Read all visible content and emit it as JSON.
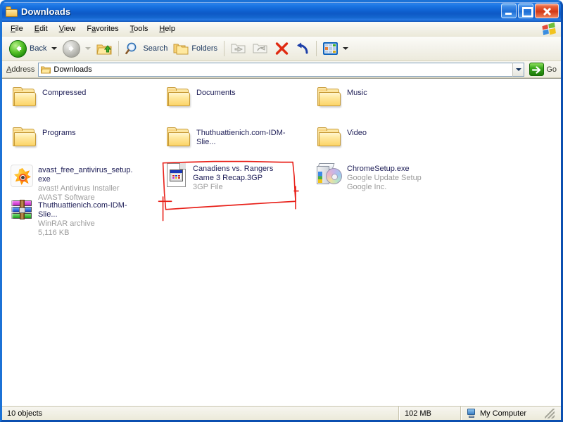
{
  "window": {
    "title": "Downloads",
    "folder_icon": "folder-icon",
    "buttons": {
      "minimize": "minimize-button",
      "maximize": "maximize-button",
      "close": "close-button"
    }
  },
  "menubar": {
    "items": [
      {
        "label": "File",
        "accel": "F"
      },
      {
        "label": "Edit",
        "accel": "E"
      },
      {
        "label": "View",
        "accel": "V"
      },
      {
        "label": "Favorites",
        "accel": "a"
      },
      {
        "label": "Tools",
        "accel": "T"
      },
      {
        "label": "Help",
        "accel": "H"
      }
    ],
    "logo": "windows-flag-logo"
  },
  "toolbar": {
    "back_label": "Back",
    "search_label": "Search",
    "folders_label": "Folders",
    "icons": {
      "back": "back-arrow-icon",
      "forward": "forward-arrow-icon",
      "up": "up-folder-icon",
      "search": "magnifier-icon",
      "folders": "folders-icon",
      "move_to": "move-to-folder-icon",
      "copy_to": "copy-to-folder-icon",
      "delete": "delete-x-icon",
      "undo": "undo-arrow-icon",
      "views": "views-icon"
    }
  },
  "address": {
    "label": "Address",
    "value": "Downloads",
    "placeholder": "Downloads",
    "folder_icon": "folder-icon",
    "dropdown_icon": "chevron-down-icon",
    "go_label": "Go",
    "go_icon": "go-arrow-icon"
  },
  "content": {
    "items": [
      {
        "name": "Compressed",
        "sub1": "",
        "sub2": "",
        "icon": "folder-icon",
        "type": "folder",
        "col": 0,
        "row": 0
      },
      {
        "name": "Documents",
        "sub1": "",
        "sub2": "",
        "icon": "folder-icon",
        "type": "folder",
        "col": 1,
        "row": 0
      },
      {
        "name": "Music",
        "sub1": "",
        "sub2": "",
        "icon": "folder-icon",
        "type": "folder",
        "col": 2,
        "row": 0
      },
      {
        "name": "Programs",
        "sub1": "",
        "sub2": "",
        "icon": "folder-icon",
        "type": "folder",
        "col": 0,
        "row": 1
      },
      {
        "name": "Thuthuattienich.com-IDM-Slie...",
        "sub1": "",
        "sub2": "",
        "icon": "folder-icon",
        "type": "folder",
        "col": 1,
        "row": 1
      },
      {
        "name": "Video",
        "sub1": "",
        "sub2": "",
        "icon": "folder-icon",
        "type": "folder",
        "col": 2,
        "row": 1
      },
      {
        "name": "avast_free_antivirus_setup.exe",
        "sub1": "avast! Antivirus Installer",
        "sub2": "AVAST Software",
        "icon": "avast-icon",
        "type": "file",
        "col": 0,
        "row": 2
      },
      {
        "name": "Canadiens vs. Rangers Game 3 Recap.3GP",
        "sub1": "3GP File",
        "sub2": "",
        "icon": "video-file-icon",
        "type": "file",
        "col": 1,
        "row": 2
      },
      {
        "name": "ChromeSetup.exe",
        "sub1": "Google Update Setup",
        "sub2": "Google Inc.",
        "icon": "setup-package-icon",
        "type": "file",
        "col": 2,
        "row": 2
      },
      {
        "name": "Thuthuattienich.com-IDM-Slie...",
        "sub1": "WinRAR archive",
        "sub2": "5,116 KB",
        "icon": "winrar-icon",
        "type": "file",
        "col": 0,
        "row": 3
      }
    ],
    "annotation": {
      "kind": "hand-drawn-red-outline",
      "color": "#e8211a",
      "target": "Canadiens vs. Rangers Game 3 Recap.3GP"
    }
  },
  "statusbar": {
    "objects": "10 objects",
    "size": "102 MB",
    "location": "My Computer",
    "location_icon": "my-computer-icon"
  },
  "colors": {
    "title_blue": "#0f62d2",
    "accent_green": "#3aa81c",
    "delete_red": "#e02b12",
    "annotation_red": "#e8211a",
    "folder_yellow": "#fcd367",
    "link_blue": "#16335c"
  }
}
